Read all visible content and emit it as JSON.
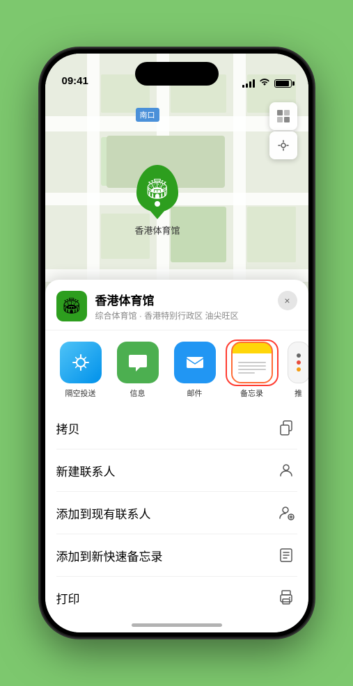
{
  "status": {
    "time": "09:41",
    "location_arrow": "▶"
  },
  "map": {
    "south_gate_label": "南口",
    "location_name": "香港体育馆",
    "marker_emoji": "🏟"
  },
  "place_card": {
    "name": "香港体育馆",
    "subtitle": "综合体育馆 · 香港特别行政区 油尖旺区",
    "close_label": "×"
  },
  "share_actions": [
    {
      "id": "airdrop",
      "label": "隔空投送",
      "type": "airdrop"
    },
    {
      "id": "messages",
      "label": "信息",
      "type": "messages"
    },
    {
      "id": "mail",
      "label": "邮件",
      "type": "mail"
    },
    {
      "id": "notes",
      "label": "备忘录",
      "type": "notes"
    },
    {
      "id": "more",
      "label": "推",
      "type": "more"
    }
  ],
  "menu_items": [
    {
      "id": "copy",
      "label": "拷贝",
      "icon": "copy"
    },
    {
      "id": "new_contact",
      "label": "新建联系人",
      "icon": "person"
    },
    {
      "id": "add_existing",
      "label": "添加到现有联系人",
      "icon": "person_add"
    },
    {
      "id": "quick_note",
      "label": "添加到新快速备忘录",
      "icon": "note"
    },
    {
      "id": "print",
      "label": "打印",
      "icon": "print"
    }
  ],
  "colors": {
    "green_marker": "#2d9e1e",
    "notes_highlight": "#ff6b35",
    "airdrop_bg": "#4fc3f7"
  }
}
